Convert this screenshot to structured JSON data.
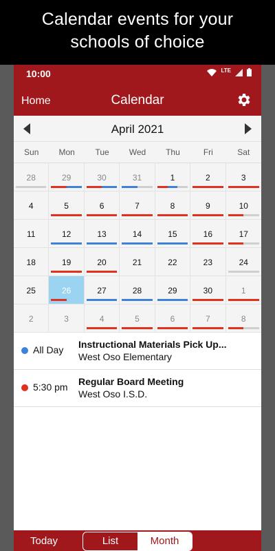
{
  "promo": {
    "line1": "Calendar events for your",
    "line2": "schools of choice"
  },
  "status": {
    "time": "10:00",
    "network": "LTE"
  },
  "app_bar": {
    "home_label": "Home",
    "title": "Calendar"
  },
  "month": {
    "label": "April 2021"
  },
  "weekdays": [
    "Sun",
    "Mon",
    "Tue",
    "Wed",
    "Thu",
    "Fri",
    "Sat"
  ],
  "colors": {
    "brand": "#a0171c",
    "red": "#e0301e",
    "blue": "#3d82d8",
    "gray": "#cfcfcf",
    "selected": "#9bd4f0"
  },
  "days": [
    {
      "n": "28",
      "other": true,
      "bars": [
        "gray"
      ]
    },
    {
      "n": "29",
      "other": true,
      "bars": [
        "red",
        "blue"
      ]
    },
    {
      "n": "30",
      "other": true,
      "bars": [
        "red",
        "blue"
      ]
    },
    {
      "n": "31",
      "other": true,
      "bars": [
        "blue",
        "gray"
      ]
    },
    {
      "n": "1",
      "bars": [
        "red",
        "blue",
        "gray"
      ]
    },
    {
      "n": "2",
      "bars": [
        "red"
      ]
    },
    {
      "n": "3",
      "bars": [
        "red"
      ]
    },
    {
      "n": "4",
      "bars": []
    },
    {
      "n": "5",
      "bars": [
        "red"
      ]
    },
    {
      "n": "6",
      "bars": [
        "red"
      ]
    },
    {
      "n": "7",
      "bars": [
        "red"
      ]
    },
    {
      "n": "8",
      "bars": [
        "red"
      ]
    },
    {
      "n": "9",
      "bars": [
        "red"
      ]
    },
    {
      "n": "10",
      "bars": [
        "red",
        "gray"
      ]
    },
    {
      "n": "11",
      "bars": []
    },
    {
      "n": "12",
      "bars": [
        "blue"
      ]
    },
    {
      "n": "13",
      "bars": [
        "blue"
      ]
    },
    {
      "n": "14",
      "bars": [
        "blue"
      ]
    },
    {
      "n": "15",
      "bars": [
        "blue"
      ]
    },
    {
      "n": "16",
      "bars": [
        "red"
      ]
    },
    {
      "n": "17",
      "bars": [
        "red",
        "gray"
      ]
    },
    {
      "n": "18",
      "bars": []
    },
    {
      "n": "19",
      "bars": [
        "red"
      ]
    },
    {
      "n": "20",
      "bars": [
        "red"
      ]
    },
    {
      "n": "21",
      "bars": []
    },
    {
      "n": "22",
      "bars": []
    },
    {
      "n": "23",
      "bars": []
    },
    {
      "n": "24",
      "bars": [
        "gray"
      ]
    },
    {
      "n": "25",
      "bars": []
    },
    {
      "n": "26",
      "selected": true,
      "bars": [
        "red",
        "selected"
      ]
    },
    {
      "n": "27",
      "bars": [
        "blue"
      ]
    },
    {
      "n": "28",
      "bars": [
        "blue"
      ]
    },
    {
      "n": "29",
      "bars": [
        "blue"
      ]
    },
    {
      "n": "30",
      "bars": [
        "red"
      ]
    },
    {
      "n": "1",
      "other": true,
      "bars": [
        "red"
      ]
    },
    {
      "n": "2",
      "other": true,
      "bars": []
    },
    {
      "n": "3",
      "other": true,
      "bars": []
    },
    {
      "n": "4",
      "other": true,
      "bars": [
        "red"
      ]
    },
    {
      "n": "5",
      "other": true,
      "bars": [
        "red"
      ]
    },
    {
      "n": "6",
      "other": true,
      "bars": [
        "red"
      ]
    },
    {
      "n": "7",
      "other": true,
      "bars": [
        "red"
      ]
    },
    {
      "n": "8",
      "other": true,
      "bars": [
        "red",
        "gray"
      ]
    }
  ],
  "events": [
    {
      "time": "All Day",
      "title": "Instructional Materials Pick Up...",
      "location": "West Oso Elementary",
      "dot": "blue"
    },
    {
      "time": "5:30 pm",
      "title": "Regular Board Meeting",
      "location": "West Oso I.S.D.",
      "dot": "red"
    }
  ],
  "bottom": {
    "today_label": "Today",
    "list_label": "List",
    "month_label": "Month"
  }
}
